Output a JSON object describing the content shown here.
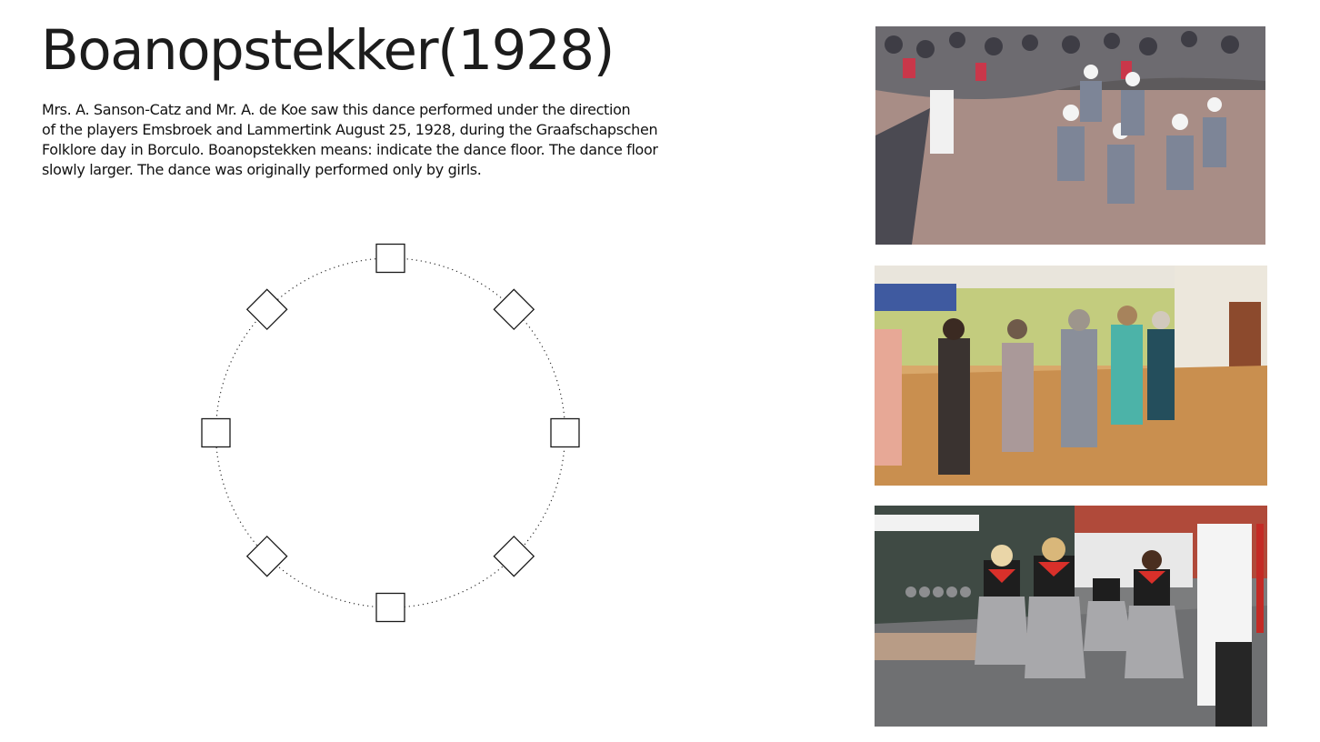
{
  "page": {
    "title": "Boanopstekker(1928)",
    "description_lines": [
      "Mrs. A. Sanson-Catz and Mr. A. de Koe saw this dance performed under the direction",
      "of the players Emsbroek and Lammertink August 25, 1928, during the Graafschapschen",
      "Folklore day in Borculo. Boanopstekken means: indicate the dance floor. The dance floor",
      "slowly larger. The dance was originally performed only by girls."
    ]
  },
  "formation": {
    "dancer_count": 8,
    "dancer_symbols": [
      "square",
      "diamond",
      "square",
      "diamond",
      "square",
      "diamond",
      "square",
      "diamond"
    ]
  },
  "photos": [
    {
      "subject": "dancers-in-traditional-white-caps-circle-outdoor-crowd"
    },
    {
      "subject": "seniors-holding-hands-in-circle-indoor-hall"
    },
    {
      "subject": "dancers-with-red-scarves-grey-skirts-street-festival"
    }
  ]
}
